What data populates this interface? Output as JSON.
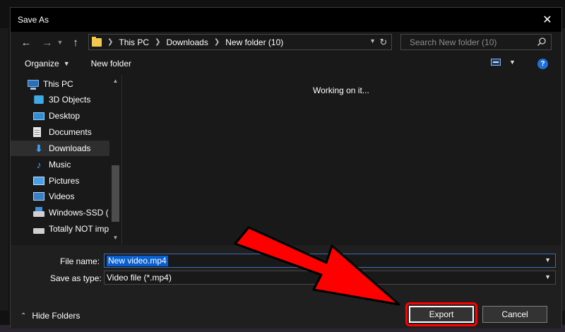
{
  "window": {
    "title": "Save As",
    "close_glyph": "✕"
  },
  "nav": {
    "back_icon": "back-arrow-icon",
    "forward_icon": "forward-arrow-icon",
    "up_icon": "up-arrow-icon",
    "breadcrumbs": [
      "This PC",
      "Downloads",
      "New folder (10)"
    ],
    "search_placeholder": "Search New folder (10)"
  },
  "toolbar": {
    "organize_label": "Organize",
    "new_folder_label": "New folder",
    "help_label": "?"
  },
  "sidebar": {
    "items": [
      {
        "label": "This PC",
        "icon": "computer-icon"
      },
      {
        "label": "3D Objects",
        "icon": "3d-objects-icon"
      },
      {
        "label": "Desktop",
        "icon": "desktop-icon"
      },
      {
        "label": "Documents",
        "icon": "documents-icon"
      },
      {
        "label": "Downloads",
        "icon": "downloads-icon",
        "selected": true
      },
      {
        "label": "Music",
        "icon": "music-icon"
      },
      {
        "label": "Pictures",
        "icon": "pictures-icon"
      },
      {
        "label": "Videos",
        "icon": "videos-icon"
      },
      {
        "label": "Windows-SSD (",
        "icon": "drive-icon"
      },
      {
        "label": "Totally NOT imp",
        "icon": "network-drive-icon"
      }
    ]
  },
  "content": {
    "status_message": "Working on it..."
  },
  "form": {
    "file_name_label": "File name:",
    "file_name_value": "New video.mp4",
    "save_type_label": "Save as type:",
    "save_type_value": "Video file (*.mp4)",
    "hide_folders_label": "Hide Folders",
    "export_label": "Export",
    "cancel_label": "Cancel"
  },
  "annotation": {
    "arrow_color": "#ff0000",
    "highlight_color": "#ff0000"
  }
}
